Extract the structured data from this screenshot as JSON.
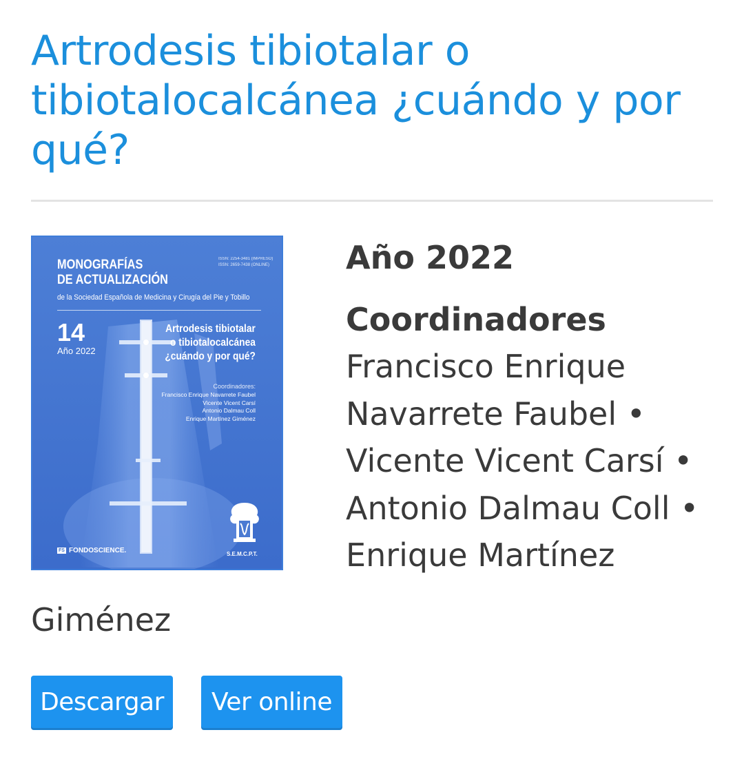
{
  "page": {
    "title": "Artrodesis tibiotalar o tibiotalocalcánea ¿cuándo y por qué?"
  },
  "cover": {
    "series_line1": "MONOGRAFÍAS",
    "series_line2": "DE ACTUALIZACIÓN",
    "society": "de la Sociedad Española de Medicina y Cirugía del Pie y Tobillo",
    "issn_print": "ISSN: 2254-3481 (IMPRESO)",
    "issn_online": "ISSN: 2659-7438 (ONLINE)",
    "number": "14",
    "year": "Año 2022",
    "title_line1": "Artrodesis tibiotalar",
    "title_line2": "o tibiotalocalcánea",
    "title_line3": "¿cuándo y por qué?",
    "coordinators_label": "Coordinadores:",
    "coordinators": [
      "Francisco Enrique Navarrete Faubel",
      "Vicente Vicent Carsí",
      "Antonio Dalmau Coll",
      "Enrique Martínez Giménez"
    ],
    "publisher_logo": "FS",
    "publisher": "FONDOSCIENCE.",
    "society_logo_text": "S.E.M.C.P.T."
  },
  "meta": {
    "year_label": "Año 2022",
    "coordinators_heading": "Coordinadores",
    "coordinator_lines": [
      "Francisco Enrique",
      "Navarrete Faubel •",
      "Vicente Vicent Carsí •",
      "Antonio Dalmau Coll •",
      "Enrique Martínez"
    ],
    "coordinator_tail": "Giménez"
  },
  "actions": {
    "download_label": "Descargar",
    "online_label": "Ver online"
  },
  "colors": {
    "title": "#1b8fdc",
    "button": "#1d93ef",
    "cover": "#4a7ad2",
    "text": "#3a3a3a"
  }
}
